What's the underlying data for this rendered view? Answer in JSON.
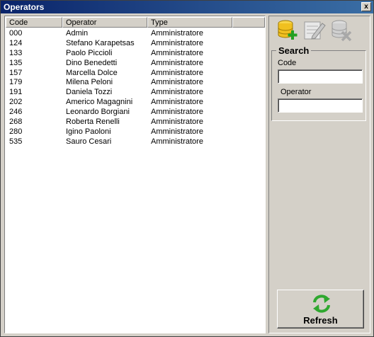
{
  "window": {
    "title": "Operators",
    "close_label": "x"
  },
  "list": {
    "columns": [
      "Code",
      "Operator",
      "Type"
    ],
    "rows": [
      [
        "000",
        "Admin",
        "Amministratore"
      ],
      [
        "124",
        "Stefano Karapetsas",
        "Amministratore"
      ],
      [
        "133",
        "Paolo Piccioli",
        "Amministratore"
      ],
      [
        "135",
        "Dino Benedetti",
        "Amministratore"
      ],
      [
        "157",
        "Marcella Dolce",
        "Amministratore"
      ],
      [
        "179",
        "Milena Peloni",
        "Amministratore"
      ],
      [
        "191",
        "Daniela Tozzi",
        "Amministratore"
      ],
      [
        "202",
        "Americo Magagnini",
        "Amministratore"
      ],
      [
        "246",
        "Leonardo Borgiani",
        "Amministratore"
      ],
      [
        "268",
        "Roberta Renelli",
        "Amministratore"
      ],
      [
        "280",
        "Igino Paoloni",
        "Amministratore"
      ],
      [
        "535",
        "Sauro Cesari",
        "Amministratore"
      ]
    ]
  },
  "toolbar": {
    "add_icon": "database-add-icon",
    "edit_icon": "edit-icon",
    "delete_icon": "database-delete-icon"
  },
  "search": {
    "title": "Search",
    "code_label": "Code",
    "code_value": "",
    "operator_label": "Operator",
    "operator_value": ""
  },
  "refresh": {
    "label": "Refresh",
    "icon": "refresh-icon"
  },
  "colors": {
    "titlebar_start": "#0a246a",
    "titlebar_end": "#3a6ea5",
    "refresh_green": "#2fa82f"
  }
}
